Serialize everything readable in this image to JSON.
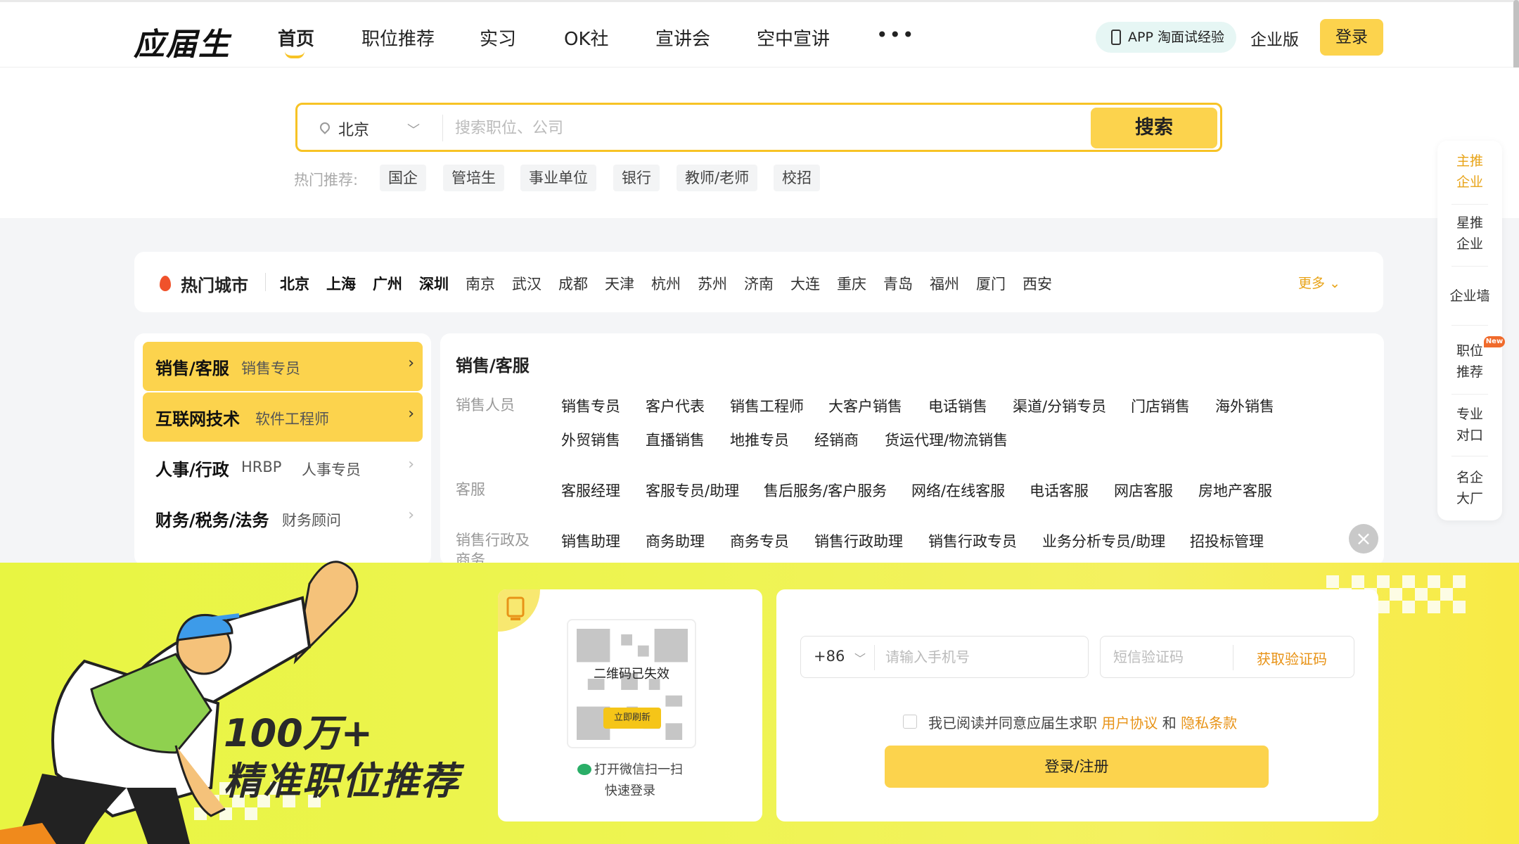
{
  "header": {
    "logo": "应届生",
    "nav": [
      "首页",
      "职位推荐",
      "实习",
      "OK社",
      "宣讲会",
      "空中宣讲"
    ],
    "more": "•••",
    "app_pill": "APP 淘面试经验",
    "enterprise": "企业版",
    "login": "登录"
  },
  "search": {
    "city": "北京",
    "placeholder": "搜索职位、公司",
    "button": "搜索",
    "hot_label": "热门推荐:",
    "hot_tags": [
      "国企",
      "管培生",
      "事业单位",
      "银行",
      "教师/老师",
      "校招"
    ]
  },
  "cities": {
    "title": "热门城市",
    "bold": [
      "北京",
      "上海",
      "广州",
      "深圳"
    ],
    "normal": [
      "南京",
      "武汉",
      "成都",
      "天津",
      "杭州",
      "苏州",
      "济南",
      "大连",
      "重庆",
      "青岛",
      "福州",
      "厦门",
      "西安"
    ],
    "more": "更多"
  },
  "categories": [
    {
      "title": "销售/客服",
      "subs": [
        "销售专员"
      ],
      "highlight": true
    },
    {
      "title": "互联网技术",
      "subs": [
        "软件工程师"
      ],
      "highlight": true
    },
    {
      "title": "人事/行政",
      "subs": [
        "HRBP",
        "人事专员"
      ],
      "highlight": false
    },
    {
      "title": "财务/税务/法务",
      "subs": [
        "财务顾问"
      ],
      "highlight": false
    }
  ],
  "category_detail": {
    "title": "销售/客服",
    "groups": [
      {
        "name": "销售人员",
        "rows": [
          [
            "销售专员",
            "客户代表",
            "销售工程师",
            "大客户销售",
            "电话销售",
            "渠道/分销专员",
            "门店销售",
            "海外销售"
          ],
          [
            "外贸销售",
            "直播销售",
            "地推专员",
            "经销商",
            "货运代理/物流销售"
          ]
        ]
      },
      {
        "name": "客服",
        "rows": [
          [
            "客服经理",
            "客服专员/助理",
            "售后服务/客户服务",
            "网络/在线客服",
            "电话客服",
            "网店客服",
            "房地产客服"
          ]
        ]
      },
      {
        "name": "销售行政及商务",
        "rows": [
          [
            "销售助理",
            "商务助理",
            "商务专员",
            "销售行政助理",
            "销售行政专员",
            "业务分析专员/助理",
            "招投标管理"
          ]
        ]
      }
    ]
  },
  "side_float": {
    "items": [
      [
        "主推",
        "企业"
      ],
      [
        "星推",
        "企业"
      ],
      [
        "企业墙"
      ],
      [
        "职位",
        "推荐"
      ],
      [
        "专业",
        "对口"
      ],
      [
        "名企",
        "大厂"
      ]
    ],
    "badge": "New"
  },
  "banner": {
    "slogan_line1": "100万+",
    "slogan_line2": "精准职位推荐",
    "qr_expired": "二维码已失效",
    "qr_refresh": "立即刷新",
    "qr_hint1": "打开微信扫一扫",
    "qr_hint2": "快速登录",
    "country_code": "+86",
    "phone_placeholder": "请输入手机号",
    "code_placeholder": "短信验证码",
    "get_code": "获取验证码",
    "agree_prefix": "我已阅读并同意应届生求职",
    "agree_link1": "用户协议",
    "agree_and": "和",
    "agree_link2": "隐私条款",
    "submit": "登录/注册",
    "close": "×"
  },
  "colors": {
    "accent": "#fcd34d",
    "link": "#e89317",
    "banner": "#eef452"
  }
}
